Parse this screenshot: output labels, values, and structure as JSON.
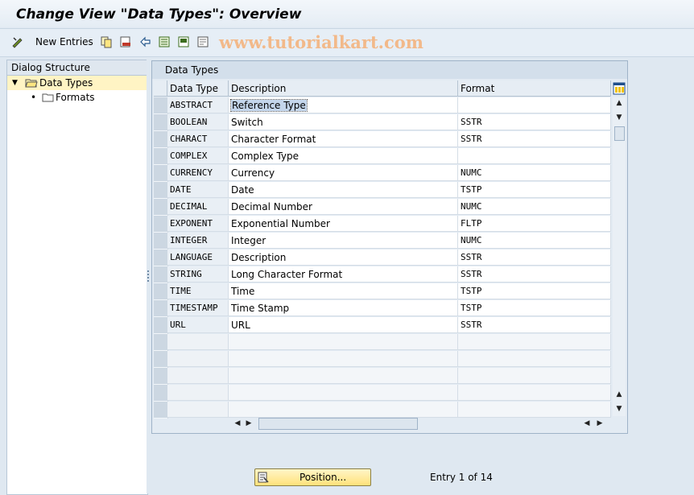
{
  "window": {
    "title": "Change View \"Data Types\": Overview"
  },
  "toolbar": {
    "new_entries_label": "New Entries",
    "watermark": "www.tutorialkart.com"
  },
  "dialog_structure": {
    "header": "Dialog Structure",
    "items": [
      {
        "label": "Data Types",
        "selected": true,
        "expanded": true
      },
      {
        "label": "Formats",
        "selected": false
      }
    ]
  },
  "table": {
    "title": "Data Types",
    "columns": [
      "Data Type",
      "Description",
      "Format"
    ],
    "rows": [
      {
        "type": "ABSTRACT",
        "description": "Reference Type",
        "format": ""
      },
      {
        "type": "BOOLEAN",
        "description": "Switch",
        "format": "SSTR"
      },
      {
        "type": "CHARACT",
        "description": "Character Format",
        "format": "SSTR"
      },
      {
        "type": "COMPLEX",
        "description": "Complex Type",
        "format": ""
      },
      {
        "type": "CURRENCY",
        "description": "Currency",
        "format": "NUMC"
      },
      {
        "type": "DATE",
        "description": "Date",
        "format": "TSTP"
      },
      {
        "type": "DECIMAL",
        "description": "Decimal Number",
        "format": "NUMC"
      },
      {
        "type": "EXPONENT",
        "description": "Exponential Number",
        "format": "FLTP"
      },
      {
        "type": "INTEGER",
        "description": "Integer",
        "format": "NUMC"
      },
      {
        "type": "LANGUAGE",
        "description": "Description",
        "format": "SSTR"
      },
      {
        "type": "STRING",
        "description": "Long Character Format",
        "format": "SSTR"
      },
      {
        "type": "TIME",
        "description": "Time",
        "format": "TSTP"
      },
      {
        "type": "TIMESTAMP",
        "description": "Time Stamp",
        "format": "TSTP"
      },
      {
        "type": "URL",
        "description": "URL",
        "format": "SSTR"
      }
    ]
  },
  "footer": {
    "position_label": "Position...",
    "entry_text": "Entry 1 of 14"
  }
}
